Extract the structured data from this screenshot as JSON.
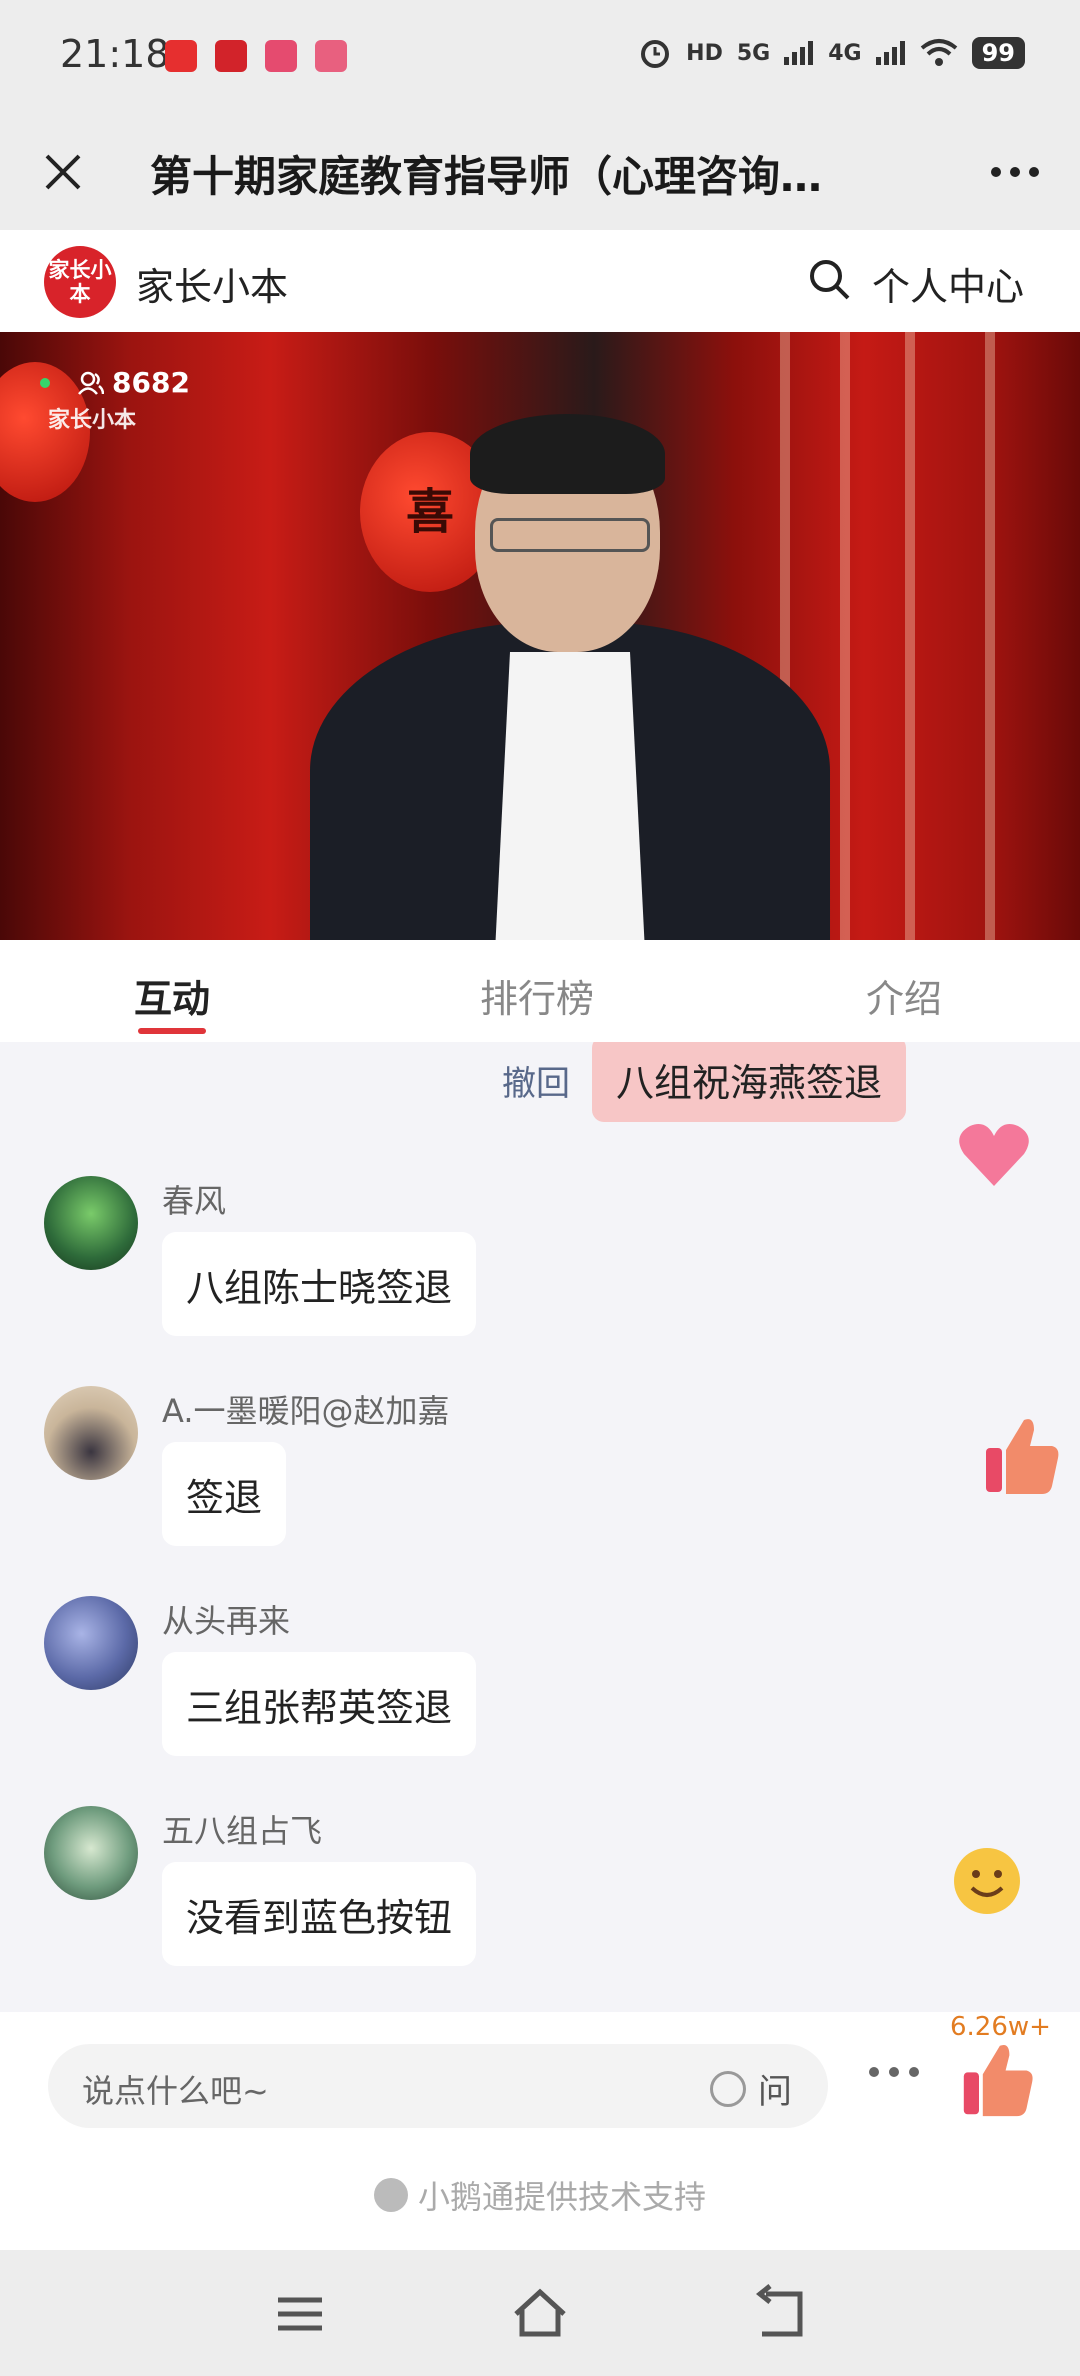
{
  "status_bar": {
    "time": "21:18",
    "indicators": [
      "HD",
      "5G",
      "4G"
    ],
    "battery": "99"
  },
  "title_bar": {
    "title": "第十期家庭教育指导师（心理咨询…"
  },
  "header": {
    "logo_text": "家长小本",
    "brand": "家长小本",
    "profile_link": "个人中心"
  },
  "video": {
    "viewer_count": "8682",
    "watermark": "家长小本",
    "lantern_text": "喜"
  },
  "tabs": [
    {
      "label": "互动",
      "active": true
    },
    {
      "label": "排行榜",
      "active": false
    },
    {
      "label": "介绍",
      "active": false
    }
  ],
  "chat": {
    "own_message": {
      "recall_label": "撤回",
      "text": "八组祝海燕签退"
    },
    "messages": [
      {
        "nickname": "春风",
        "text": "八组陈士晓签退",
        "avatar_color": "#2e6b3a"
      },
      {
        "nickname": "A.一墨暖阳@赵加嘉",
        "text": "签退",
        "avatar_color": "#c9b59a"
      },
      {
        "nickname": "从头再来",
        "text": "三组张帮英签退",
        "avatar_color": "#5c6aa8"
      },
      {
        "nickname": "五八组占飞",
        "text": "没看到蓝色按钮",
        "avatar_color": "#6f9c7e"
      }
    ]
  },
  "footer": {
    "input_placeholder": "说点什么吧~",
    "ask_label": "问",
    "like_count": "6.26w+",
    "tech_support": "小鹅通提供技术支持"
  },
  "colors": {
    "accent": "#e0353a",
    "self_bubble": "#f7c6c6",
    "like_count": "#e27c21"
  }
}
